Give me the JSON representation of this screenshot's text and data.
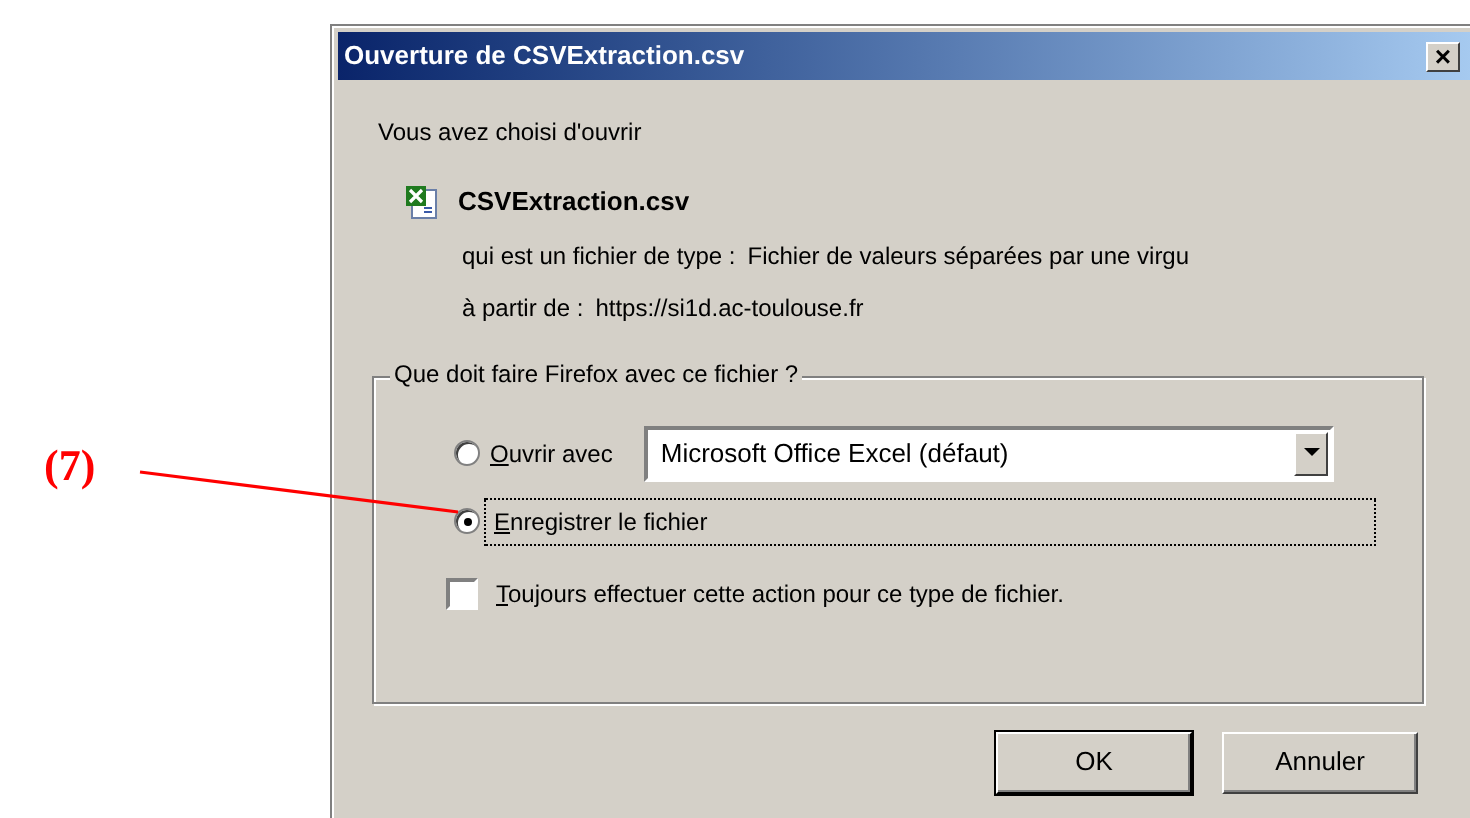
{
  "annotation": {
    "label": "(7)"
  },
  "window": {
    "title": "Ouverture de CSVExtraction.csv",
    "close": "×"
  },
  "intro": "Vous avez choisi d'ouvrir",
  "file": {
    "name": "CSVExtraction.csv",
    "type_label": "qui est un fichier de type :",
    "type_value": "Fichier de valeurs séparées par une virgu",
    "from_label": "à partir de :",
    "from_value": "https://si1d.ac-toulouse.fr"
  },
  "group": {
    "legend": "Que doit faire Firefox avec ce fichier ?",
    "options": [
      {
        "label": "Ouvrir avec",
        "selected": false,
        "focused": false
      },
      {
        "label": "Enregistrer le fichier",
        "selected": true,
        "focused": true
      }
    ],
    "application": {
      "value": "Microsoft Office Excel (défaut)"
    },
    "always": {
      "label": "Toujours effectuer cette action pour ce type de fichier.",
      "checked": false
    }
  },
  "buttons": [
    {
      "label": "OK",
      "default": true
    },
    {
      "label": "Annuler",
      "default": false
    }
  ]
}
